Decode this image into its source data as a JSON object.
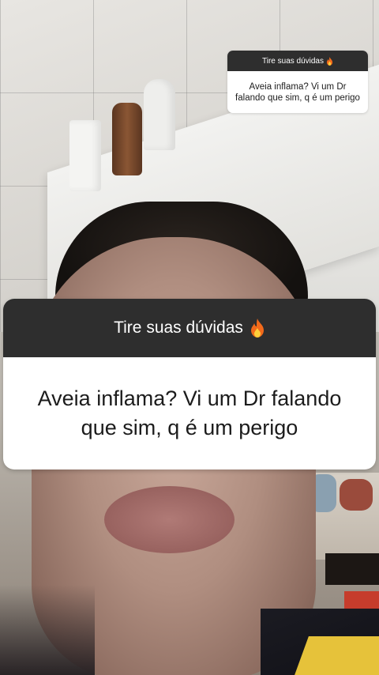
{
  "sticker_small": {
    "header": "Tire suas dúvidas",
    "icon": "fire-icon",
    "question": "Aveia inflama? Vi um Dr falando que sim, q é um perigo"
  },
  "sticker_large": {
    "header": "Tire suas dúvidas",
    "icon": "fire-icon",
    "question_line1": "Aveia inflama? Vi um Dr falando",
    "question_line2": "que sim, q é um perigo"
  },
  "colors": {
    "sticker_header_bg": "#2e2e2e",
    "sticker_body_bg": "#ffffff",
    "fire": "#f26a1b"
  }
}
